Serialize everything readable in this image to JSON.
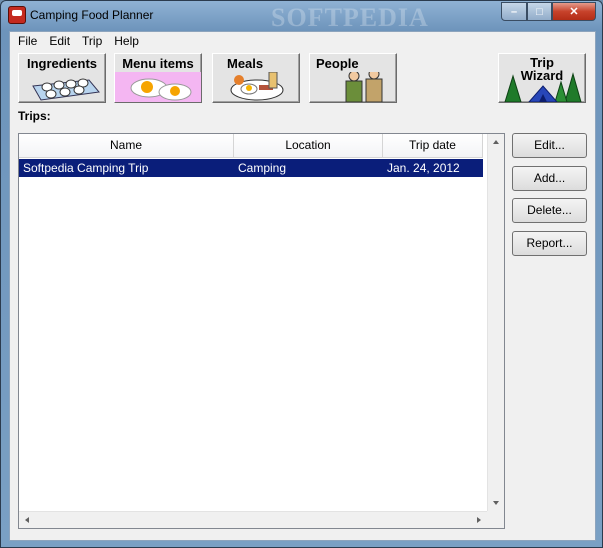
{
  "window": {
    "title": "Camping Food Planner",
    "watermark": "SOFTPEDIA",
    "controls": {
      "minimize": "–",
      "maximize": "□",
      "close": "✕"
    }
  },
  "menu": [
    "File",
    "Edit",
    "Trip",
    "Help"
  ],
  "toolbar": [
    {
      "label": "Ingredients",
      "icon": "eggs-carton-icon"
    },
    {
      "label": "Menu items",
      "icon": "fried-eggs-icon"
    },
    {
      "label": "Meals",
      "icon": "meal-plate-icon"
    },
    {
      "label": "People",
      "icon": "campers-icon"
    },
    {
      "label": "Trip\nWizard",
      "label_line1": "Trip",
      "label_line2": "Wizard",
      "icon": "tent-trees-icon"
    }
  ],
  "trips_label": "Trips:",
  "table": {
    "columns": [
      "Name",
      "Location",
      "Trip date"
    ],
    "rows": [
      [
        "Softpedia Camping Trip",
        "Camping",
        "Jan. 24, 2012"
      ]
    ]
  },
  "buttons": {
    "edit": "Edit...",
    "add": "Add...",
    "delete": "Delete...",
    "report": "Report..."
  },
  "colors": {
    "selection": "#0a1e7a",
    "titlebar": "#7aa0c4"
  }
}
